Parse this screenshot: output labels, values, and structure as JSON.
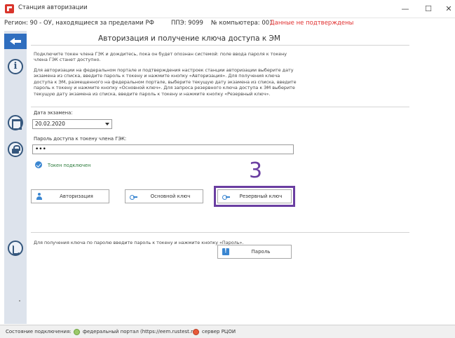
{
  "window": {
    "title": "Станция авторизации",
    "controls": {
      "minimize": "—",
      "maximize": "☐",
      "close": "✕"
    }
  },
  "region_bar": {
    "region": "Регион: 90 - ОУ, находящиеся за пределами РФ",
    "ppe": "ППЭ: 9099",
    "computer": "№ компьютера: 001",
    "warning": "Данные не подтверждены",
    "warning_color": "#e03030"
  },
  "header": {
    "title": "Авторизация и получение ключа доступа к ЭМ"
  },
  "info": {
    "para1": "Подключите токен члена ГЭК и дождитесь, пока он будет опознан системой: поле ввода пароля к токену члена ГЭК станет доступно.",
    "para2": "Для авторизации на федеральном портале и подтверждения настроек станции авторизации выберите дату экзамена из списка, введите пароль к токену и нажмите кнопку «Авторизация». Для получения ключа доступа к ЭМ, размещенного на федеральном портале, выберите текущую дату экзамена из списка, введите пароль к токену и нажмите кнопку «Основной ключ». Для запроса резервного ключа доступа к ЭМ выберите текущую дату экзамена из списка, введите пароль к токену и нажмите кнопку «Резервный ключ»."
  },
  "form": {
    "date_label": "Дата экзамена:",
    "date_value": "20.02.2020",
    "password_label": "Пароль доступа к токену члена ГЭК:",
    "password_value": "•••",
    "token_status": "Токен подключен"
  },
  "annotation": {
    "step_number": "3",
    "color": "#6a3ea1"
  },
  "buttons": {
    "auth": "Авторизация",
    "main_key": "Основной ключ",
    "reserve_key": "Резервный ключ",
    "password": "Пароль"
  },
  "password_section": {
    "text": "Для получения ключа по паролю введите пароль к токену и нажмите кнопку «Пароль»."
  },
  "status_bar": {
    "label": "Состояние подключения:",
    "federal": "федеральный портал (https://eem.rustest.ru)",
    "server": "сервер РЦОИ",
    "federal_color": "#9cc96b",
    "server_color": "#e85a3a"
  },
  "icons": [
    "app-icon",
    "back-arrow-icon",
    "info-icon",
    "calendar-icon",
    "lock-icon",
    "phone-icon",
    "check-icon",
    "user-icon",
    "key-icon",
    "password-icon"
  ]
}
